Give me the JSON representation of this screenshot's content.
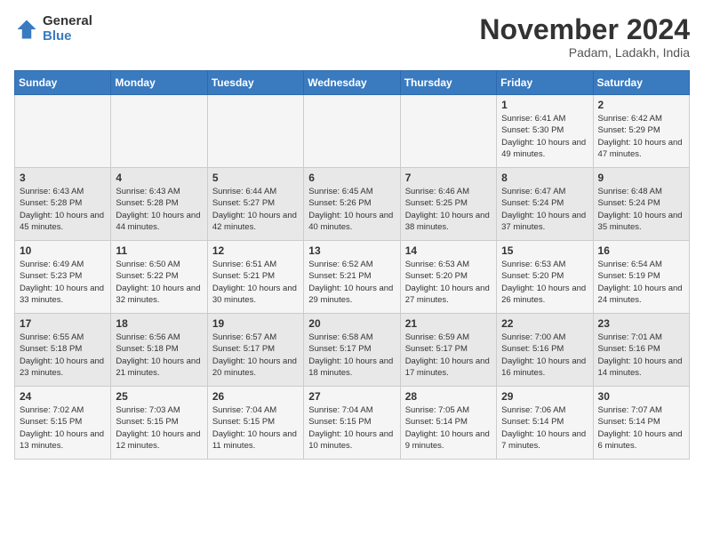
{
  "header": {
    "logo_general": "General",
    "logo_blue": "Blue",
    "month_title": "November 2024",
    "location": "Padam, Ladakh, India"
  },
  "days_of_week": [
    "Sunday",
    "Monday",
    "Tuesday",
    "Wednesday",
    "Thursday",
    "Friday",
    "Saturday"
  ],
  "weeks": [
    [
      {
        "day": "",
        "info": ""
      },
      {
        "day": "",
        "info": ""
      },
      {
        "day": "",
        "info": ""
      },
      {
        "day": "",
        "info": ""
      },
      {
        "day": "",
        "info": ""
      },
      {
        "day": "1",
        "info": "Sunrise: 6:41 AM\nSunset: 5:30 PM\nDaylight: 10 hours and 49 minutes."
      },
      {
        "day": "2",
        "info": "Sunrise: 6:42 AM\nSunset: 5:29 PM\nDaylight: 10 hours and 47 minutes."
      }
    ],
    [
      {
        "day": "3",
        "info": "Sunrise: 6:43 AM\nSunset: 5:28 PM\nDaylight: 10 hours and 45 minutes."
      },
      {
        "day": "4",
        "info": "Sunrise: 6:43 AM\nSunset: 5:28 PM\nDaylight: 10 hours and 44 minutes."
      },
      {
        "day": "5",
        "info": "Sunrise: 6:44 AM\nSunset: 5:27 PM\nDaylight: 10 hours and 42 minutes."
      },
      {
        "day": "6",
        "info": "Sunrise: 6:45 AM\nSunset: 5:26 PM\nDaylight: 10 hours and 40 minutes."
      },
      {
        "day": "7",
        "info": "Sunrise: 6:46 AM\nSunset: 5:25 PM\nDaylight: 10 hours and 38 minutes."
      },
      {
        "day": "8",
        "info": "Sunrise: 6:47 AM\nSunset: 5:24 PM\nDaylight: 10 hours and 37 minutes."
      },
      {
        "day": "9",
        "info": "Sunrise: 6:48 AM\nSunset: 5:24 PM\nDaylight: 10 hours and 35 minutes."
      }
    ],
    [
      {
        "day": "10",
        "info": "Sunrise: 6:49 AM\nSunset: 5:23 PM\nDaylight: 10 hours and 33 minutes."
      },
      {
        "day": "11",
        "info": "Sunrise: 6:50 AM\nSunset: 5:22 PM\nDaylight: 10 hours and 32 minutes."
      },
      {
        "day": "12",
        "info": "Sunrise: 6:51 AM\nSunset: 5:21 PM\nDaylight: 10 hours and 30 minutes."
      },
      {
        "day": "13",
        "info": "Sunrise: 6:52 AM\nSunset: 5:21 PM\nDaylight: 10 hours and 29 minutes."
      },
      {
        "day": "14",
        "info": "Sunrise: 6:53 AM\nSunset: 5:20 PM\nDaylight: 10 hours and 27 minutes."
      },
      {
        "day": "15",
        "info": "Sunrise: 6:53 AM\nSunset: 5:20 PM\nDaylight: 10 hours and 26 minutes."
      },
      {
        "day": "16",
        "info": "Sunrise: 6:54 AM\nSunset: 5:19 PM\nDaylight: 10 hours and 24 minutes."
      }
    ],
    [
      {
        "day": "17",
        "info": "Sunrise: 6:55 AM\nSunset: 5:18 PM\nDaylight: 10 hours and 23 minutes."
      },
      {
        "day": "18",
        "info": "Sunrise: 6:56 AM\nSunset: 5:18 PM\nDaylight: 10 hours and 21 minutes."
      },
      {
        "day": "19",
        "info": "Sunrise: 6:57 AM\nSunset: 5:17 PM\nDaylight: 10 hours and 20 minutes."
      },
      {
        "day": "20",
        "info": "Sunrise: 6:58 AM\nSunset: 5:17 PM\nDaylight: 10 hours and 18 minutes."
      },
      {
        "day": "21",
        "info": "Sunrise: 6:59 AM\nSunset: 5:17 PM\nDaylight: 10 hours and 17 minutes."
      },
      {
        "day": "22",
        "info": "Sunrise: 7:00 AM\nSunset: 5:16 PM\nDaylight: 10 hours and 16 minutes."
      },
      {
        "day": "23",
        "info": "Sunrise: 7:01 AM\nSunset: 5:16 PM\nDaylight: 10 hours and 14 minutes."
      }
    ],
    [
      {
        "day": "24",
        "info": "Sunrise: 7:02 AM\nSunset: 5:15 PM\nDaylight: 10 hours and 13 minutes."
      },
      {
        "day": "25",
        "info": "Sunrise: 7:03 AM\nSunset: 5:15 PM\nDaylight: 10 hours and 12 minutes."
      },
      {
        "day": "26",
        "info": "Sunrise: 7:04 AM\nSunset: 5:15 PM\nDaylight: 10 hours and 11 minutes."
      },
      {
        "day": "27",
        "info": "Sunrise: 7:04 AM\nSunset: 5:15 PM\nDaylight: 10 hours and 10 minutes."
      },
      {
        "day": "28",
        "info": "Sunrise: 7:05 AM\nSunset: 5:14 PM\nDaylight: 10 hours and 9 minutes."
      },
      {
        "day": "29",
        "info": "Sunrise: 7:06 AM\nSunset: 5:14 PM\nDaylight: 10 hours and 7 minutes."
      },
      {
        "day": "30",
        "info": "Sunrise: 7:07 AM\nSunset: 5:14 PM\nDaylight: 10 hours and 6 minutes."
      }
    ]
  ]
}
